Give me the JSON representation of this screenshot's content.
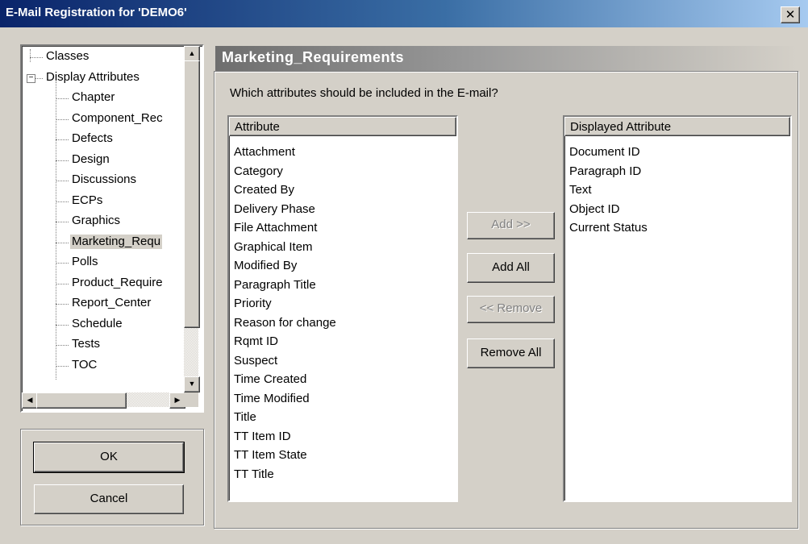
{
  "window": {
    "title": "E-Mail Registration for 'DEMO6'",
    "close_glyph": "✕"
  },
  "tree": {
    "items": [
      {
        "label": "Classes",
        "level": 0
      },
      {
        "label": "Display Attributes",
        "level": 0,
        "expander": "−"
      },
      {
        "label": "Chapter",
        "level": 1
      },
      {
        "label": "Component_Rec",
        "level": 1
      },
      {
        "label": "Defects",
        "level": 1
      },
      {
        "label": "Design",
        "level": 1
      },
      {
        "label": "Discussions",
        "level": 1
      },
      {
        "label": "ECPs",
        "level": 1
      },
      {
        "label": "Graphics",
        "level": 1
      },
      {
        "label": "Marketing_Requ",
        "level": 1,
        "selected": true
      },
      {
        "label": "Polls",
        "level": 1
      },
      {
        "label": "Product_Require",
        "level": 1
      },
      {
        "label": "Report_Center",
        "level": 1
      },
      {
        "label": "Schedule",
        "level": 1
      },
      {
        "label": "Tests",
        "level": 1
      },
      {
        "label": "TOC",
        "level": 1
      }
    ]
  },
  "dialog_buttons": {
    "ok": "OK",
    "cancel": "Cancel"
  },
  "panel": {
    "title": "Marketing_Requirements",
    "prompt": "Which attributes should be included in the E-mail?"
  },
  "attribute_list": {
    "header": "Attribute",
    "items": [
      "Attachment",
      "Category",
      "Created By",
      "Delivery Phase",
      "File Attachment",
      "Graphical Item",
      "Modified By",
      "Paragraph Title",
      "Priority",
      "Reason for change",
      "Rqmt ID",
      "Suspect",
      "Time Created",
      "Time Modified",
      "Title",
      "TT Item ID",
      "TT Item State",
      "TT Title"
    ]
  },
  "displayed_list": {
    "header": "Displayed Attribute",
    "items": [
      "Document ID",
      "Paragraph ID",
      "Text",
      "Object ID",
      "Current Status"
    ]
  },
  "transfer_buttons": {
    "add": "Add >>",
    "add_all": "Add All",
    "remove": "<< Remove",
    "remove_all": "Remove All"
  },
  "icons": {
    "scroll_up": "▲",
    "scroll_down": "▼",
    "scroll_left": "◀",
    "scroll_right": "▶"
  }
}
